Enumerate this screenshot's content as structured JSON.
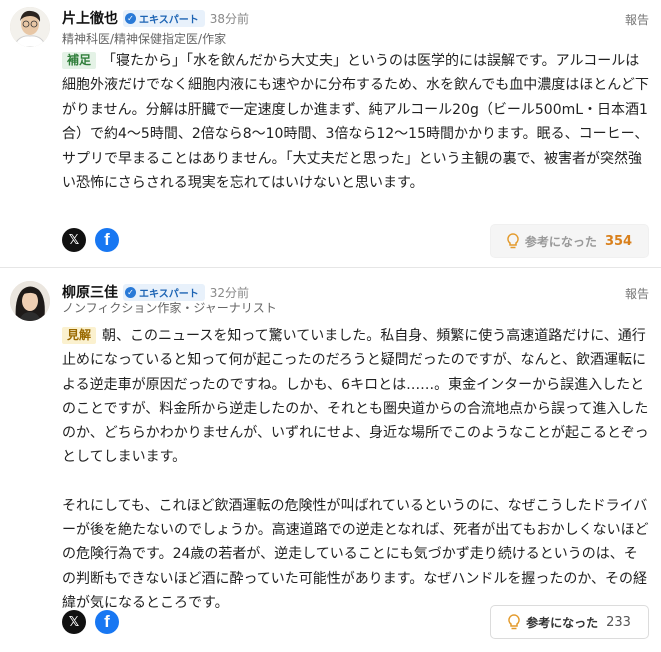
{
  "comments": [
    {
      "name": "片上徹也",
      "badge": "エキスパート",
      "time": "38分前",
      "profession": "精神科医/精神保健指定医/作家",
      "report": "報告",
      "tag": "補足",
      "paragraphs": [
        "「寝たから」「水を飲んだから大丈夫」というのは医学的には誤解です。アルコールは細胞外液だけでなく細胞内液にも速やかに分布するため、水を飲んでも血中濃度はほとんど下がりません。分解は肝臓で一定速度しか進まず、純アルコール20g（ビール500mL・日本酒1合）で約4〜5時間、2倍なら8〜10時間、3倍なら12〜15時間かかります。眠る、コーヒー、サプリで早まることはありません。「大丈夫だと思った」という主観の裏で、被害者が突然強い恐怖にさらされる現実を忘れてはいけないと思います。"
      ],
      "share_x": "𝕏",
      "share_fb": "f",
      "helpful_label": "参考になった",
      "helpful_count": "354"
    },
    {
      "name": "柳原三佳",
      "badge": "エキスパート",
      "time": "32分前",
      "profession": "ノンフィクション作家・ジャーナリスト",
      "report": "報告",
      "tag": "見解",
      "paragraphs": [
        "朝、このニュースを知って驚いていました。私自身、頻繁に使う高速道路だけに、通行止めになっていると知って何が起こったのだろうと疑問だったのですが、なんと、飲酒運転による逆走車が原因だったのですね。しかも、6キロとは……。東金インターから誤進入したとのことですが、料金所から逆走したのか、それとも圏央道からの合流地点から誤って進入したのか、どちらかわかりませんが、いずれにせよ、身近な場所でこのようなことが起こるとぞっとしてしまいます。",
        "それにしても、これほど飲酒運転の危険性が叫ばれているというのに、なぜこうしたドライバーが後を絶たないのでしょうか。高速道路での逆走となれば、死者が出てもおかしくないほどの危険行為です。24歳の若者が、逆走していることにも気づかず走り続けるというのは、その判断もできないほど酒に酔っていた可能性があります。なぜハンドルを握ったのか、その経緯が気になるところです。"
      ],
      "share_x": "𝕏",
      "share_fb": "f",
      "helpful_label": "参考になった",
      "helpful_count": "233"
    }
  ]
}
